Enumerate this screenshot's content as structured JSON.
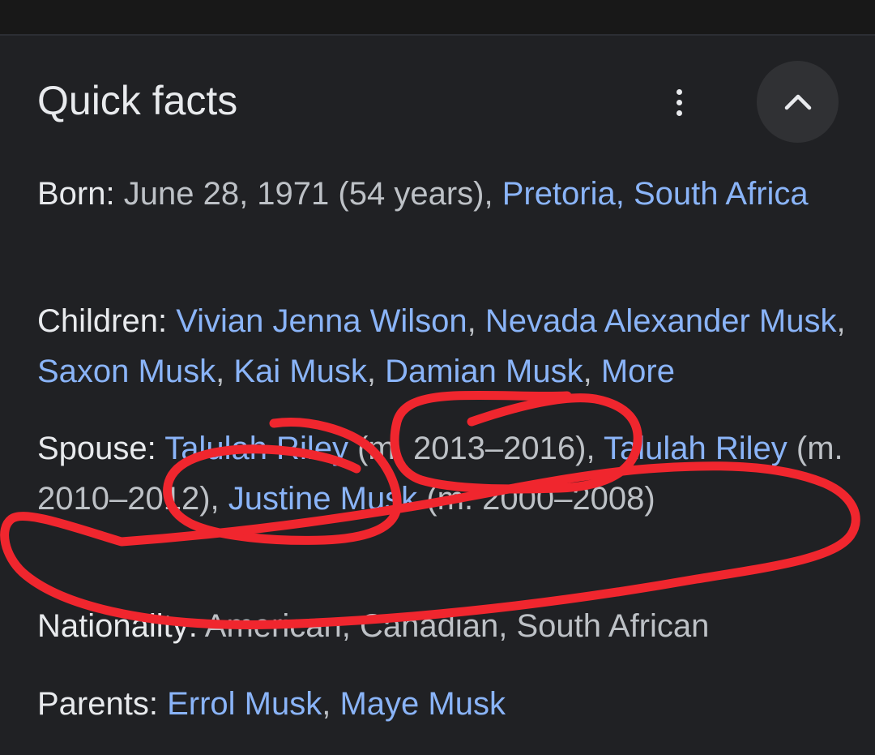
{
  "card": {
    "title": "Quick facts"
  },
  "icons": {
    "more": "more-vert-icon",
    "collapse": "chevron-up-icon"
  },
  "facts": [
    {
      "label": "Born",
      "segments": [
        {
          "text": "June 28, 1971 (54 years), ",
          "link": false
        },
        {
          "text": "Pretoria, South Africa",
          "link": true
        }
      ]
    },
    {
      "label": "Children",
      "segments": [
        {
          "text": "Vivian Jenna Wilson",
          "link": true
        },
        {
          "text": ", ",
          "link": false
        },
        {
          "text": "Nevada Alexander Musk",
          "link": true
        },
        {
          "text": ", ",
          "link": false
        },
        {
          "text": "Saxon Musk",
          "link": true
        },
        {
          "text": ", ",
          "link": false
        },
        {
          "text": "Kai Musk",
          "link": true
        },
        {
          "text": ", ",
          "link": false
        },
        {
          "text": "Damian Musk",
          "link": true
        },
        {
          "text": ", ",
          "link": false
        },
        {
          "text": "More",
          "link": true
        }
      ]
    },
    {
      "label": "Spouse",
      "segments": [
        {
          "text": "Talulah Riley",
          "link": true
        },
        {
          "text": " (m. 2013–2016), ",
          "link": false
        },
        {
          "text": "Talulah Riley",
          "link": true
        },
        {
          "text": " (m. 2010–2012), ",
          "link": false
        },
        {
          "text": "Justine Musk",
          "link": true
        },
        {
          "text": " (m. 2000–2008)",
          "link": false
        }
      ]
    },
    {
      "label": "Nationality",
      "segments": [
        {
          "text": "American, Canadian, South African",
          "link": false
        }
      ]
    },
    {
      "label": "Parents",
      "segments": [
        {
          "text": "Errol Musk",
          "link": true
        },
        {
          "text": ", ",
          "link": false
        },
        {
          "text": "Maye Musk",
          "link": true
        }
      ]
    }
  ],
  "colors": {
    "background": "#202124",
    "label": "#e8eaed",
    "text": "#bdc1c6",
    "link": "#8ab4f8",
    "annotation": "#f0262e"
  }
}
